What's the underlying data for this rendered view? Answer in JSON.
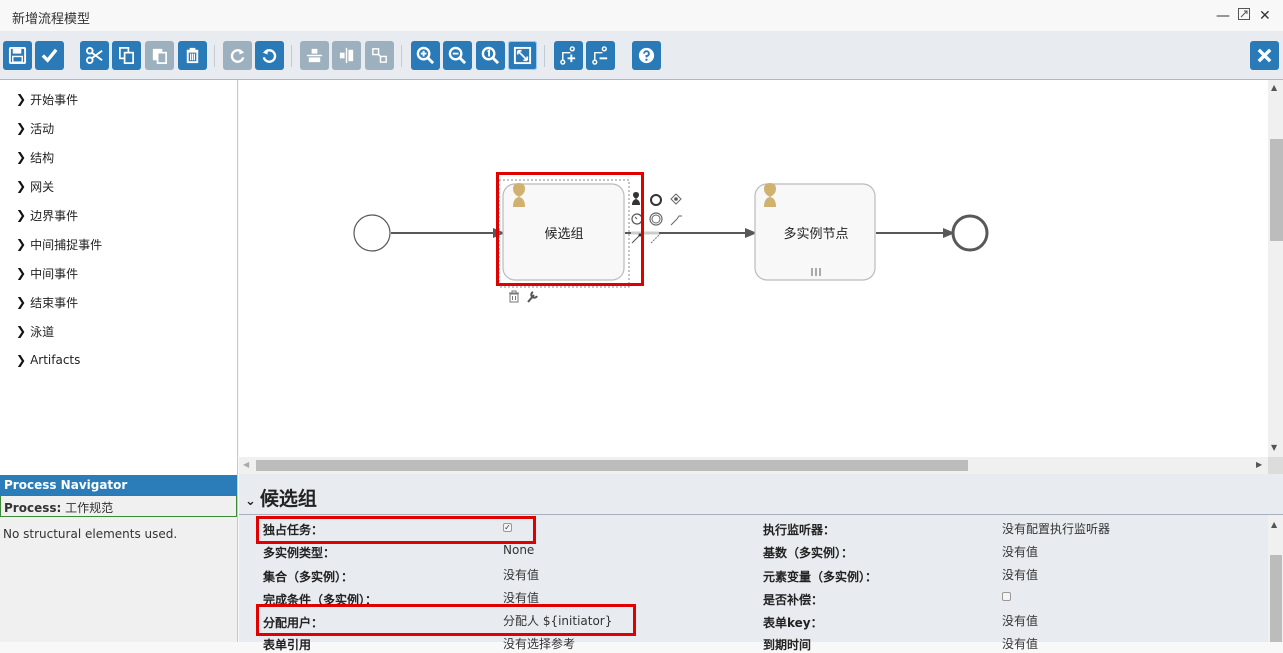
{
  "window": {
    "title": "新增流程模型",
    "controls": [
      "minimize",
      "maximize",
      "close"
    ]
  },
  "toolbar": {
    "buttons": [
      {
        "name": "save",
        "icon": "floppy-icon",
        "enabled": true
      },
      {
        "name": "validate",
        "icon": "check-icon",
        "enabled": true
      },
      {
        "name": "cut",
        "icon": "scissors-icon",
        "enabled": true
      },
      {
        "name": "copy",
        "icon": "copy-icon",
        "enabled": true
      },
      {
        "name": "paste",
        "icon": "paste-icon",
        "enabled": false
      },
      {
        "name": "delete",
        "icon": "trash-icon",
        "enabled": true
      },
      {
        "name": "redo",
        "icon": "redo-icon",
        "enabled": false
      },
      {
        "name": "undo",
        "icon": "undo-icon",
        "enabled": true
      },
      {
        "name": "align-vertical",
        "icon": "align-vertical-icon",
        "enabled": false
      },
      {
        "name": "align-horizontal",
        "icon": "align-horizontal-icon",
        "enabled": false
      },
      {
        "name": "same-size",
        "icon": "same-size-icon",
        "enabled": false
      },
      {
        "name": "zoom-in",
        "icon": "zoom-in-icon",
        "enabled": true
      },
      {
        "name": "zoom-out",
        "icon": "zoom-out-icon",
        "enabled": true
      },
      {
        "name": "zoom-actual",
        "icon": "zoom-actual-icon",
        "enabled": true
      },
      {
        "name": "zoom-fit",
        "icon": "zoom-fit-icon",
        "enabled": true,
        "active": true
      },
      {
        "name": "add-bendpoint",
        "icon": "bendpoint-add-icon",
        "enabled": true
      },
      {
        "name": "remove-bendpoint",
        "icon": "bendpoint-remove-icon",
        "enabled": true
      },
      {
        "name": "help",
        "icon": "help-icon",
        "enabled": true
      },
      {
        "name": "close-editor",
        "icon": "close-icon",
        "enabled": true
      }
    ]
  },
  "palette": {
    "groups": [
      "开始事件",
      "活动",
      "结构",
      "网关",
      "边界事件",
      "中间捕捉事件",
      "中间事件",
      "结束事件",
      "泳道",
      "Artifacts"
    ]
  },
  "navigator": {
    "title": "Process Navigator",
    "process_label": "Process:",
    "process_name": "工作规范",
    "empty_text": "No structural elements used."
  },
  "diagram": {
    "nodes": [
      {
        "type": "start-event",
        "label": ""
      },
      {
        "type": "user-task",
        "label": "候选组",
        "selected": true
      },
      {
        "type": "user-task",
        "label": "多实例节点",
        "multi_instance": true
      },
      {
        "type": "end-event",
        "label": ""
      }
    ]
  },
  "properties": {
    "title": "候选组",
    "left": [
      {
        "label": "独占任务：",
        "value": "",
        "checkbox": true,
        "checked": true
      },
      {
        "label": "多实例类型：",
        "value": "None"
      },
      {
        "label": "集合（多实例）：",
        "value": "没有值"
      },
      {
        "label": "完成条件（多实例）：",
        "value": "没有值"
      },
      {
        "label": "分配用户：",
        "value": "分配人 ${initiator}"
      },
      {
        "label": "表单引用",
        "value": "没有选择参考"
      }
    ],
    "right": [
      {
        "label": "执行监听器：",
        "value": "没有配置执行监听器"
      },
      {
        "label": "基数（多实例）：",
        "value": "没有值"
      },
      {
        "label": "元素变量（多实例）：",
        "value": "没有值"
      },
      {
        "label": "是否补偿：",
        "value": "",
        "checkbox": true,
        "checked": false
      },
      {
        "label": "表单key：",
        "value": "没有值"
      },
      {
        "label": "到期时间",
        "value": "没有值"
      }
    ]
  },
  "colors": {
    "accent": "#2a7ab8",
    "disabled": "#9db0bd",
    "highlight": "#e00000",
    "task_icon": "#d1b170"
  }
}
